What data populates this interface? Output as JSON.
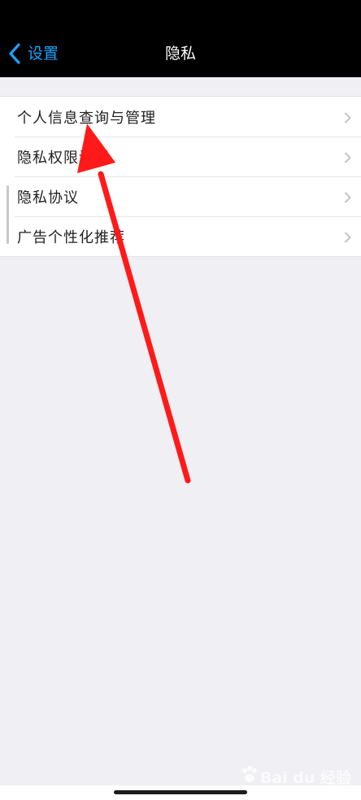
{
  "navbar": {
    "back_label": "设置",
    "title": "隐私"
  },
  "menu": {
    "items": [
      {
        "label": "个人信息查询与管理"
      },
      {
        "label": "隐私权限设置"
      },
      {
        "label": "隐私协议"
      },
      {
        "label": "广告个性化推荐"
      }
    ]
  },
  "watermark": {
    "text": "Bai du 经验"
  },
  "colors": {
    "navbar_bg": "#000000",
    "accent": "#1aa3ff",
    "annotation_arrow": "#ff1a1a",
    "background": "#efeff4"
  },
  "icons": {
    "back": "chevron-left-icon",
    "row_disclosure": "chevron-right-icon",
    "watermark_logo": "paw-icon"
  }
}
